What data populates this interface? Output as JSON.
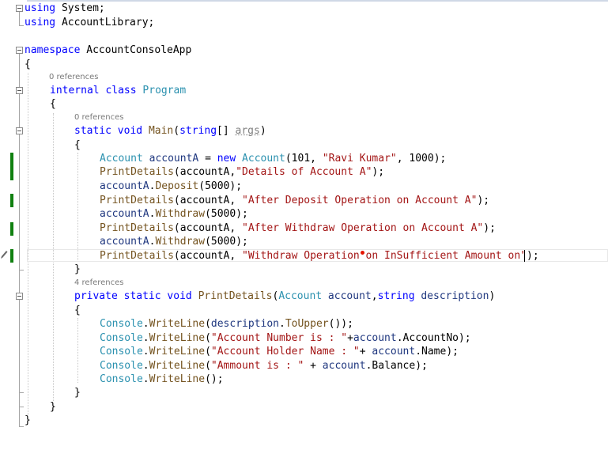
{
  "codelens": {
    "program_refs": "0 references",
    "main_refs": "0 references",
    "printdetails_refs": "4 references"
  },
  "code": {
    "l1": {
      "k": "using",
      "rest": " System;"
    },
    "l2": {
      "k": "using",
      "rest": " AccountLibrary;"
    },
    "l3": {
      "k": "namespace",
      "rest": " AccountConsoleApp"
    },
    "l4": "{",
    "l5": {
      "k1": "internal",
      "k2": "class",
      "t": "Program"
    },
    "l6": "{",
    "l7": {
      "k1": "static",
      "k2": "void",
      "m": "Main",
      "p1": "(",
      "k3": "string",
      "p2": "[] ",
      "a": "args",
      "p3": ")"
    },
    "l8": "{",
    "l9": {
      "t": "Account",
      "v": " accountA",
      "p1": " = ",
      "k": "new",
      "t2": " Account",
      "p2": "(101, ",
      "s": "\"Ravi Kumar\"",
      "p3": ", 1000);"
    },
    "l10": {
      "m": "PrintDetails",
      "p1": "(accountA,",
      "s": "\"Details of Account A\"",
      "p2": ");"
    },
    "l11": {
      "v": "accountA",
      "p1": ".",
      "m": "Deposit",
      "p2": "(5000);"
    },
    "l12": {
      "m": "PrintDetails",
      "p1": "(accountA, ",
      "s": "\"After Deposit Operation on Account A\"",
      "p2": ");"
    },
    "l13": {
      "v": "accountA",
      "p1": ".",
      "m": "Withdraw",
      "p2": "(5000);"
    },
    "l14": {
      "m": "PrintDetails",
      "p1": "(accountA, ",
      "s": "\"After Withdraw Operation on Account A\"",
      "p2": ");"
    },
    "l15": {
      "v": "accountA",
      "p1": ".",
      "m": "Withdraw",
      "p2": "(5000);"
    },
    "l16": {
      "m": "PrintDetails",
      "p1": "(accountA, ",
      "s": "\"Withdraw Operation on InSufficient Amount on\"",
      "p2": ");"
    },
    "l17": "}",
    "l18": {
      "k1": "private",
      "k2": "static",
      "k3": "void",
      "m": "PrintDetails",
      "p1": "(",
      "t": "Account",
      "v1": " account",
      "p2": ",",
      "k4": "string",
      "v2": " description",
      "p3": ")"
    },
    "l19": "{",
    "l20": {
      "t": "Console",
      "p1": ".",
      "m": "WriteLine",
      "p2": "(",
      "v": "description",
      "p3": ".",
      "m2": "ToUpper",
      "p4": "());"
    },
    "l21": {
      "t": "Console",
      "p1": ".",
      "m": "WriteLine",
      "p2": "(",
      "s": "\"Account Number is : \"",
      "p3": "+",
      "v": "account",
      "p4": ".AccountNo);"
    },
    "l22": {
      "t": "Console",
      "p1": ".",
      "m": "WriteLine",
      "p2": "(",
      "s": "\"Account Holder Name : \"",
      "p3": "+ ",
      "v": "account",
      "p4": ".Name);"
    },
    "l23": {
      "t": "Console",
      "p1": ".",
      "m": "WriteLine",
      "p2": "(",
      "s": "\"Ammount is : \"",
      "p3": " + ",
      "v": "account",
      "p4": ".Balance);"
    },
    "l24": {
      "t": "Console",
      "p1": ".",
      "m": "WriteLine",
      "p2": "();"
    },
    "l25": "}",
    "l26": "}",
    "l27": "}"
  },
  "colors": {
    "keyword": "#0000ff",
    "type": "#2b91af",
    "string": "#a31515",
    "method": "#74531f",
    "variable": "#1f377f",
    "change_bar": "#108010"
  }
}
